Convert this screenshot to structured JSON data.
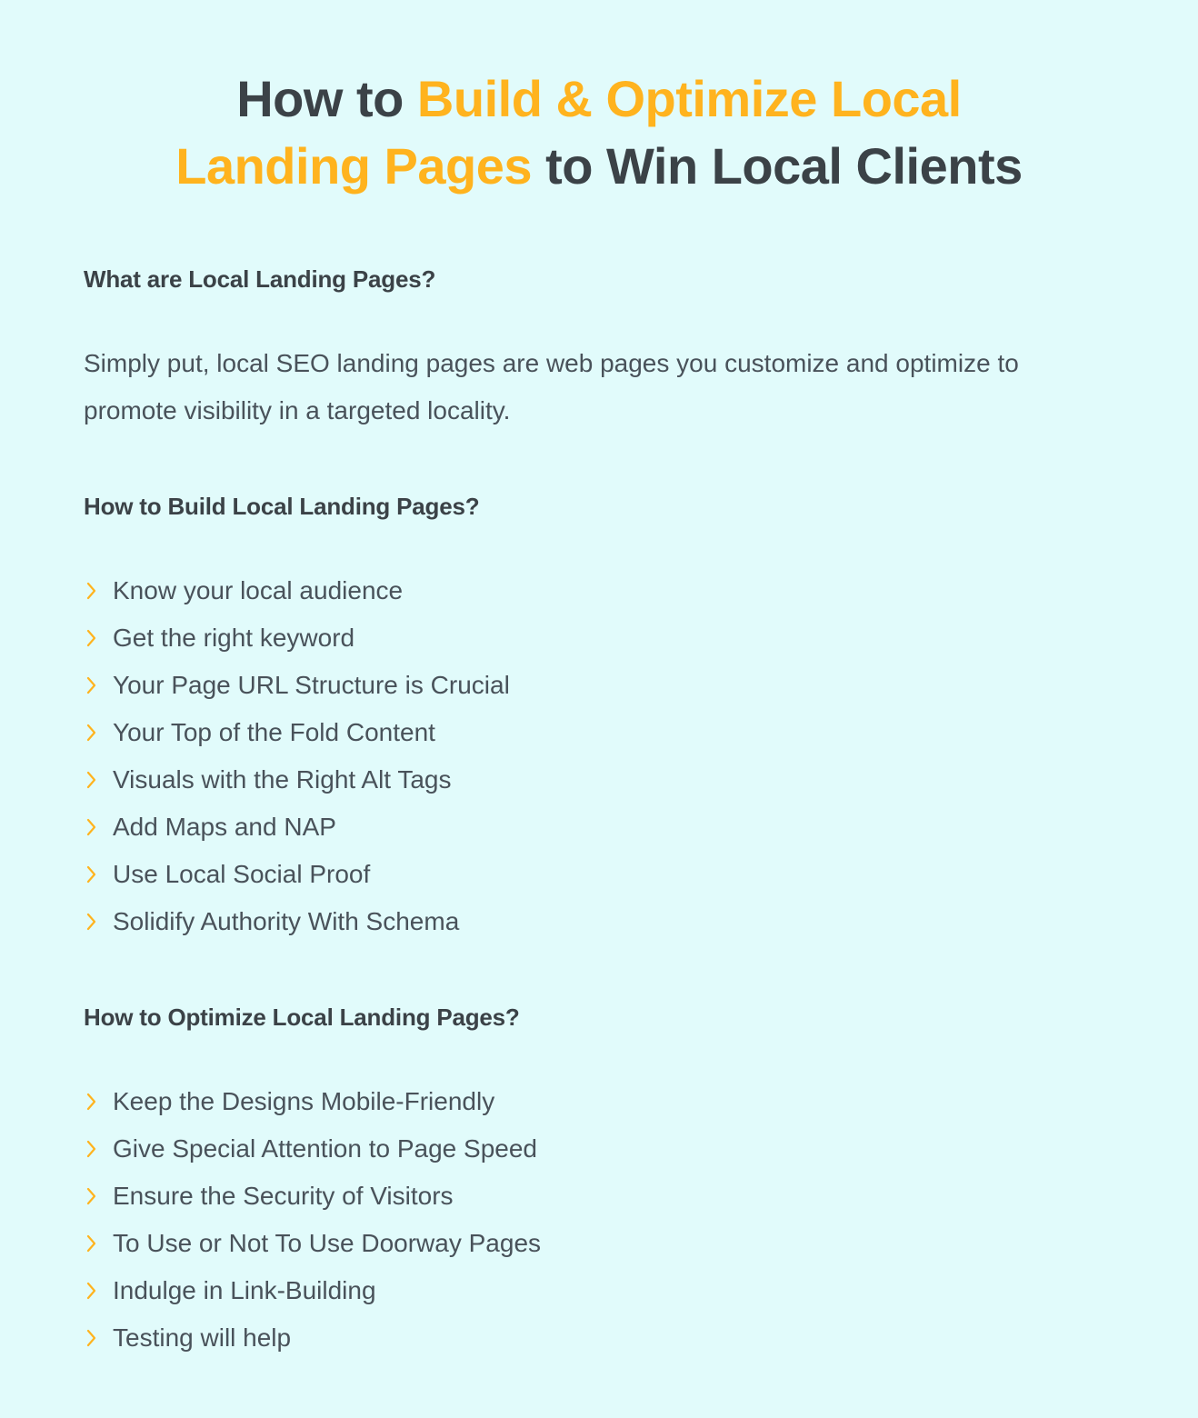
{
  "colors": {
    "background": "#e1fbfb",
    "accent_orange": "#ffb31e",
    "heading_dark": "#3b4247",
    "body_text": "#49525a"
  },
  "title": {
    "part1": "How to ",
    "accent1": "Build & Optimize Local Landing Pages",
    "part2": " to Win Local Clients",
    "line1_plain": "How to ",
    "line1_accent": "Build & Optimize Local",
    "line2_accent": "Landing Pages",
    "line2_plain": " to Win Local Clients"
  },
  "sections": [
    {
      "heading": "What are Local Landing Pages?",
      "paragraph": "Simply put, local SEO landing pages are web pages you customize and optimize to promote visibility in a targeted locality."
    },
    {
      "heading": "How to Build Local Landing Pages?",
      "items": [
        "Know your local audience",
        "Get the right keyword",
        "Your Page URL Structure is Crucial",
        "Your Top of the Fold Content",
        "Visuals with the Right Alt Tags",
        "Add Maps and NAP",
        "Use Local Social Proof",
        "Solidify Authority With Schema"
      ]
    },
    {
      "heading": "How to Optimize Local Landing Pages?",
      "items": [
        "Keep the Designs Mobile-Friendly",
        "Give Special Attention to Page Speed",
        "Ensure the Security of Visitors",
        "To Use or Not To Use Doorway Pages",
        "Indulge in Link-Building",
        "Testing will help"
      ]
    }
  ],
  "icons": {
    "bullet": "chevron-right-icon"
  }
}
